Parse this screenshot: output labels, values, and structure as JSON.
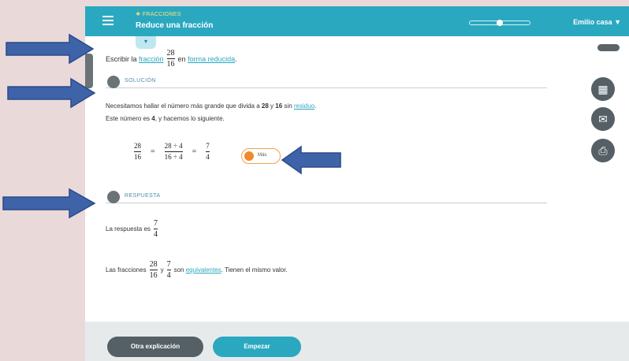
{
  "header": {
    "breadcrumb": "❖ FRACCIONES",
    "title": "Reduce una fracción",
    "user": "Emilio casa ▼",
    "menu_icon": "hamburger-icon"
  },
  "problem": {
    "prefix": "Escribir la",
    "link_fraccion": "fracción",
    "num": "28",
    "den": "16",
    "middle": "en",
    "link_forma": "forma reducida",
    "suffix": "."
  },
  "solution": {
    "heading": "SOLUCIÓN",
    "line1_pre": "Necesitamos hallar el número más grande que divida a",
    "n1": "28",
    "and": "y",
    "n2": "16",
    "line1_mid": "sin",
    "line1_link": "residuo",
    "line1_end": ".",
    "line2_pre": "Este número es",
    "n3": "4",
    "line2_end": ", y hacemos lo siguiente.",
    "math": {
      "f1_num": "28",
      "f1_den": "16",
      "eq1": "=",
      "f2_num": "28 ÷ 4",
      "f2_den": "16 ÷ 4",
      "eq2": "=",
      "f3_num": "7",
      "f3_den": "4"
    },
    "more_label": "Más"
  },
  "answer": {
    "heading": "RESPUESTA",
    "line1": "La respuesta es",
    "ans_num": "7",
    "ans_den": "4",
    "line2_pre": "Las fracciones",
    "a_num": "28",
    "a_den": "16",
    "line2_and": "y",
    "b_num": "7",
    "b_den": "4",
    "line2_mid": "son",
    "line2_link": "equivalentes",
    "line2_end": ". Tienen el mismo valor."
  },
  "footer": {
    "other_label": "Otra explicación",
    "start_label": "Empezar"
  },
  "colors": {
    "topbar": "#2aa8c0",
    "arrow": "#3f63a8",
    "round_buttons": "#546066",
    "more_accent": "#f08a2a",
    "page_bg": "#ead9d9"
  },
  "icons": {
    "dropdown": "chevron-down-icon",
    "calculator": "calculator-icon",
    "mail": "mail-icon",
    "print": "print-icon"
  }
}
